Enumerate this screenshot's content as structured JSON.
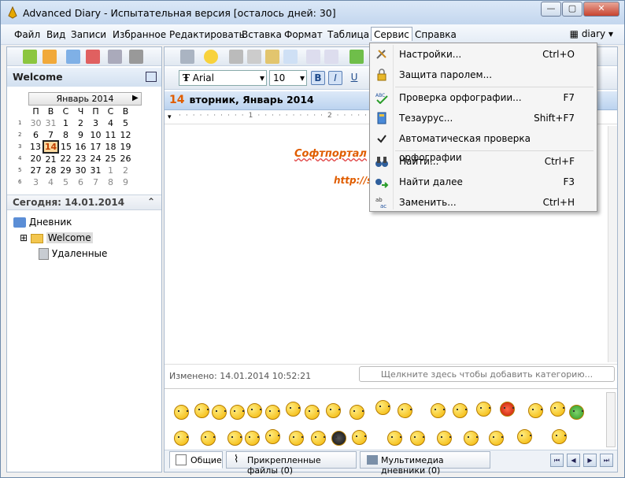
{
  "window": {
    "title": "Advanced Diary - Испытательная версия [осталось дней: 30]"
  },
  "menubar": {
    "items": [
      "Файл",
      "Вид",
      "Записи",
      "Избранное",
      "Редактировать",
      "Вставка",
      "Формат",
      "Таблица",
      "Сервис",
      "Справка"
    ],
    "active": "Сервис",
    "diary_label": "diary"
  },
  "left": {
    "welcome": "Welcome",
    "calendar": {
      "month": "Январь 2014",
      "weekdays": [
        "П",
        "В",
        "С",
        "Ч",
        "П",
        "С",
        "В"
      ],
      "weeks": [
        {
          "num": "1",
          "days": [
            "30",
            "31",
            "1",
            "2",
            "3",
            "4",
            "5"
          ]
        },
        {
          "num": "2",
          "days": [
            "6",
            "7",
            "8",
            "9",
            "10",
            "11",
            "12"
          ]
        },
        {
          "num": "3",
          "days": [
            "13",
            "14",
            "15",
            "16",
            "17",
            "18",
            "19"
          ]
        },
        {
          "num": "4",
          "days": [
            "20",
            "21",
            "22",
            "23",
            "24",
            "25",
            "26"
          ]
        },
        {
          "num": "5",
          "days": [
            "27",
            "28",
            "29",
            "30",
            "31",
            "1",
            "2"
          ]
        },
        {
          "num": "6",
          "days": [
            "3",
            "4",
            "5",
            "6",
            "7",
            "8",
            "9"
          ]
        }
      ],
      "today": "14"
    },
    "today_label": "Сегодня: 14.01.2014",
    "tree": {
      "root": "Дневник",
      "welcome": "Welcome",
      "deleted": "Удаленные"
    }
  },
  "format": {
    "font": "Arial",
    "size": "10"
  },
  "datebar": {
    "day": "14",
    "text": "вторник, Январь 2014"
  },
  "editor": {
    "line1": "Софтпортал",
    "line2": "http://so"
  },
  "status": {
    "changed": "Изменено: 14.01.2014 10:52:21",
    "category_placeholder": "Щелкните здесь чтобы добавить категорию..."
  },
  "tabs": [
    {
      "label": "Общие",
      "icon": "notepad-icon"
    },
    {
      "label": "Прикрепленные файлы (0)",
      "icon": "paperclip-icon"
    },
    {
      "label": "Мультимедиа дневники (0)",
      "icon": "film-icon"
    }
  ],
  "menu": {
    "items": [
      {
        "label": "Настройки...",
        "shortcut": "Ctrl+O",
        "icon": "tools-icon",
        "underline": "Н"
      },
      {
        "label": "Защита паролем...",
        "shortcut": "",
        "icon": "lock-icon"
      },
      {
        "label": "Проверка орфографии...",
        "shortcut": "F7",
        "icon": "spellcheck-icon"
      },
      {
        "label": "Тезаурус...",
        "shortcut": "Shift+F7",
        "icon": "book-icon"
      },
      {
        "label": "Автоматическая проверка орфографии",
        "shortcut": "",
        "icon": "check-icon"
      },
      {
        "label": "Найти...",
        "shortcut": "Ctrl+F",
        "icon": "binoculars-icon"
      },
      {
        "label": "Найти далее",
        "shortcut": "F3",
        "icon": "find-next-icon"
      },
      {
        "label": "Заменить...",
        "shortcut": "Ctrl+H",
        "icon": "replace-icon"
      }
    ]
  },
  "colors": {
    "accent_orange": "#e05d00",
    "title_bg": "#c3d6ee",
    "menu_bg": "#f5f5f5"
  }
}
